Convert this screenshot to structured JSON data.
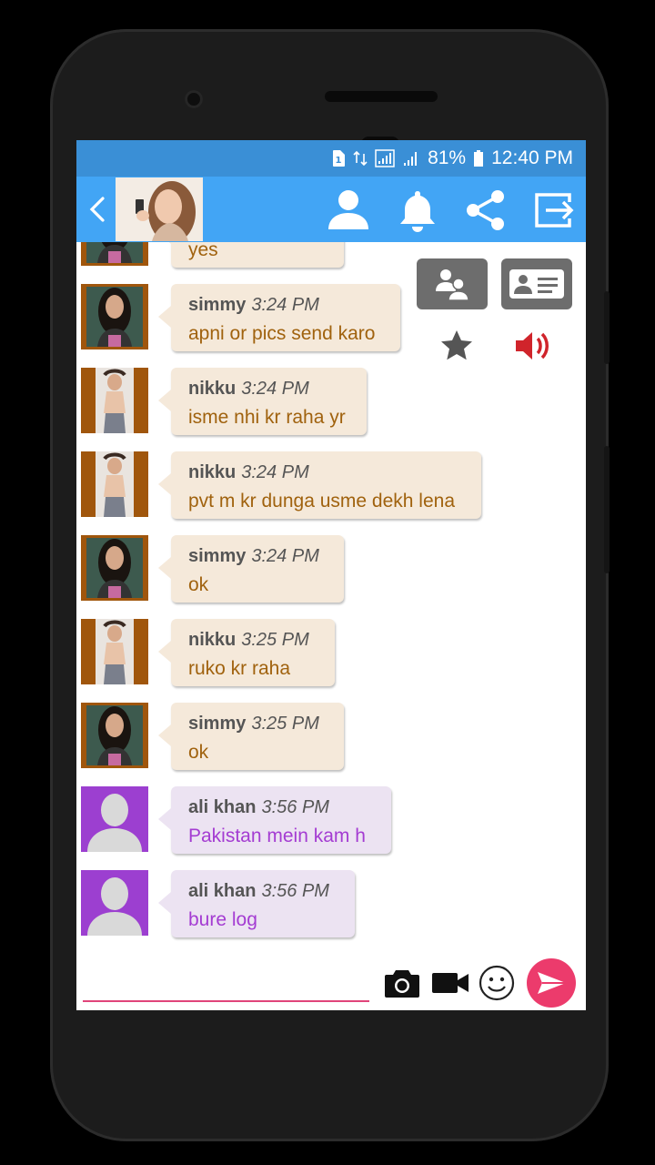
{
  "status_bar": {
    "battery": "81%",
    "time": "12:40 PM"
  },
  "app_bar": {
    "icons": [
      "back-arrow-icon",
      "profile-icon",
      "bell-icon",
      "share-icon",
      "exit-icon"
    ]
  },
  "side_panel": {
    "icons": [
      "group-icon",
      "contact-card-icon",
      "star-icon",
      "speaker-icon"
    ]
  },
  "messages": [
    {
      "name": "",
      "time": "",
      "text": "yes",
      "avatar": "female-photo",
      "style": "tan"
    },
    {
      "name": "simmy",
      "time": "3:24 PM",
      "text": "apni or pics send karo",
      "avatar": "female-photo",
      "style": "tan"
    },
    {
      "name": "nikku",
      "time": "3:24 PM",
      "text": "isme nhi kr raha yr",
      "avatar": "male-photo",
      "style": "tan"
    },
    {
      "name": "nikku",
      "time": "3:24 PM",
      "text": "pvt m kr dunga usme dekh lena",
      "avatar": "male-photo",
      "style": "tan"
    },
    {
      "name": "simmy",
      "time": "3:24 PM",
      "text": "ok",
      "avatar": "female-photo",
      "style": "tan"
    },
    {
      "name": "nikku",
      "time": "3:25 PM",
      "text": "ruko kr raha",
      "avatar": "male-photo",
      "style": "tan"
    },
    {
      "name": "simmy",
      "time": "3:25 PM",
      "text": "ok",
      "avatar": "female-photo",
      "style": "tan"
    },
    {
      "name": "ali khan",
      "time": "3:56 PM",
      "text": "Pakistan mein kam h",
      "avatar": "default-avatar",
      "style": "purple"
    },
    {
      "name": "ali khan",
      "time": "3:56 PM",
      "text": "bure log",
      "avatar": "default-avatar",
      "style": "purple"
    }
  ],
  "input_bar": {
    "message_value": "",
    "icons": [
      "camera-icon",
      "video-icon",
      "emoji-icon",
      "send-icon"
    ]
  },
  "colors": {
    "status_bar": "#3a8fd6",
    "app_bar": "#42a5f5",
    "bubble_tan": "#f5e9da",
    "bubble_purple": "#ece3f2",
    "text_tan": "#a0620e",
    "text_purple": "#a43cd2",
    "send_button": "#ec3b6c",
    "default_avatar_bg": "#9c3fd0"
  }
}
